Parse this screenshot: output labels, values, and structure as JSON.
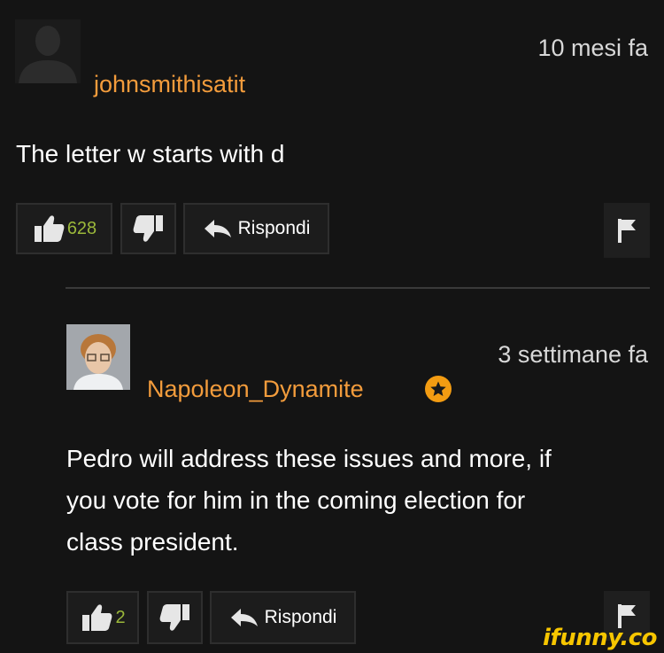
{
  "comments": [
    {
      "username": "johnsmithisatit",
      "timestamp": "10 mesi fa",
      "text": "The letter w starts with d",
      "likes": "628",
      "reply_label": "Rispondi",
      "avatar": "default-user-silhouette-icon"
    },
    {
      "username": "Napoleon_Dynamite",
      "timestamp": "3 settimane fa",
      "text_lines": [
        "Pedro will address these issues and more, if",
        "you vote for him in the coming election for",
        "class president."
      ],
      "likes": "2",
      "reply_label": "Rispondi",
      "badge_icon": "star-icon",
      "avatar": "user-photo"
    }
  ],
  "watermark": "ifunny.co",
  "colors": {
    "background": "#141414",
    "username": "#f39c3c",
    "like_count": "#9bb83a",
    "badge": "#f39c12",
    "watermark": "#f7c600"
  }
}
